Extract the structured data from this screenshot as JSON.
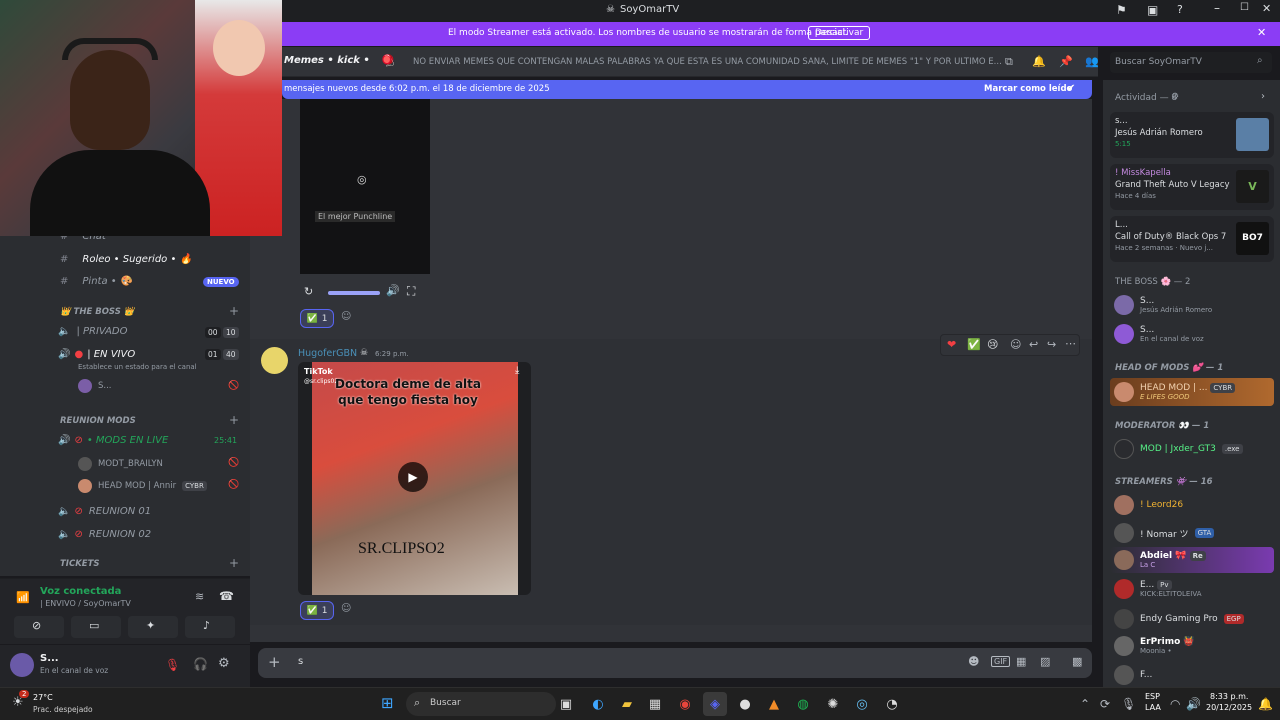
{
  "window": {
    "title": "SoyOmarTV"
  },
  "banner": {
    "text": "El modo Streamer está activado. Los nombres de usuario se mostrarán de forma parcial.",
    "button": "Desactivar"
  },
  "channel_header": {
    "name": "Memes • kick •",
    "topic": "NO ENVIAR MEMES QUE CONTENGAN MALAS PALABRAS YA QUE ESTA ES UNA COMUNIDAD SANA, LIMITE DE MEMES \"1\" Y POR ULTIMO E..."
  },
  "search": {
    "placeholder": "Buscar SoyOmarTV"
  },
  "new_messages": {
    "text": "mensajes nuevos desde 6:02 p.m. el 18 de diciembre de 2025",
    "action": "Marcar como leído"
  },
  "sidebar": {
    "channels": [
      {
        "label": "Chat"
      },
      {
        "label": "Roleo • Sugerido • 🔥"
      },
      {
        "label": "Pinta • 🎨",
        "badge": "NUEVO"
      }
    ],
    "cat_boss": "👑 THE BOSS 👑",
    "privado": {
      "label": "| PRIVADO",
      "n1": "00",
      "n2": "10"
    },
    "envivo": {
      "label": "| EN VIVO",
      "n1": "01",
      "n2": "40",
      "status": "Establece un estado para el canal",
      "user": "S..."
    },
    "cat_reunion": "REUNION MODS",
    "mods_live": {
      "label": "• MODS EN LIVE",
      "time": "25:41"
    },
    "mods_users": [
      {
        "name": "MODT_BRAILYN"
      },
      {
        "name": "HEAD MOD | Annir",
        "tag": "CYBR"
      }
    ],
    "reunion": [
      "REUNION 01",
      "REUNION 02"
    ],
    "cat_tickets": "TICKETS"
  },
  "voice": {
    "title": "Voz conectada",
    "sub": "| ENVIVO / SoyOmarTV"
  },
  "user": {
    "name": "S...",
    "status": "En el canal de voz"
  },
  "chat": {
    "video_caption": "El mejor Punchline",
    "reaction1": {
      "emoji": "✅",
      "count": "1"
    },
    "message": {
      "author": "HugoferGBN",
      "time": "6:29 p.m.",
      "video_title": "Doctora deme de alta que tengo fiesta hoy",
      "watermark": "SR.CLIPSO2",
      "tiktok": "TikTok",
      "handle": "@sr.clips02"
    },
    "reaction2": {
      "emoji": "✅",
      "count": "1"
    }
  },
  "input": {
    "value": "s"
  },
  "members": {
    "activity_header": "Actividad — 8",
    "activities": [
      {
        "user": "s...",
        "title": "Jesús Adrián Romero",
        "sub": "5:15",
        "color": "#5a7fa6"
      },
      {
        "user": "! MissKapella",
        "title": "Grand Theft Auto V Legacy",
        "sub": "Hace 4 días",
        "color": "#1a1a1a"
      },
      {
        "user": "L...",
        "title": "Call of Duty® Black Ops 7",
        "sub": "Hace 2 semanas · Nuevo j...",
        "color": "#111111"
      }
    ],
    "boss_header": "THE BOSS 🌸 — 2",
    "boss": [
      {
        "name": "S...",
        "sub": "Jesús Adrián Romero"
      },
      {
        "name": "S...",
        "sub": "En el canal de voz"
      }
    ],
    "head_header": "HEAD OF MODS 💕 — 1",
    "head": {
      "name": "HEAD MOD | ...",
      "tag": "CYBR",
      "sub": "E LIFES GOOD"
    },
    "mod_header": "MODERATOR 👀 — 1",
    "mod": {
      "name": "MOD | Jxder_GT3",
      "tag": ".exe"
    },
    "str_header": "STREAMERS 👾 — 16",
    "streamers": [
      {
        "name": "! Leord26",
        "color": "#f0b232",
        "sub": "",
        "tag": ""
      },
      {
        "name": "! Nomar ツ",
        "color": "#dbdee1",
        "sub": "",
        "tag": "GTA"
      },
      {
        "name": "Abdiel 🎀",
        "color": "#ffffff",
        "sub": "La C",
        "tag": "Re"
      },
      {
        "name": "E...",
        "color": "#dbdee1",
        "sub": "KICK:ELTITOLEIVA",
        "tag": "Pv"
      },
      {
        "name": "Endy Gaming Pro",
        "color": "#dbdee1",
        "sub": "",
        "tag": "EGP"
      },
      {
        "name": "ErPrimo 👹",
        "color": "#ffffff",
        "sub": "Moonia • ",
        "tag": ""
      },
      {
        "name": "F...",
        "color": "#dbdee1",
        "sub": "",
        "tag": ""
      }
    ]
  },
  "taskbar": {
    "weather": "27°C",
    "weather_sub": "Prac. despejado",
    "search": "Buscar",
    "lang": "ESP",
    "lang2": "LAA",
    "time": "8:33 p.m.",
    "date": "20/12/2025",
    "notif": "2"
  }
}
